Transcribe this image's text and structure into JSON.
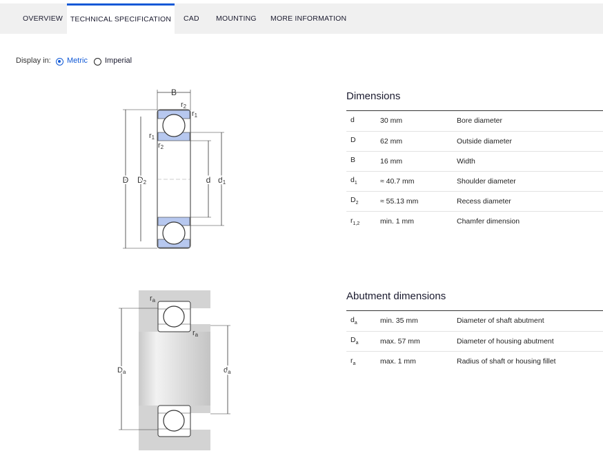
{
  "tabs": [
    {
      "label": "OVERVIEW",
      "active": false
    },
    {
      "label": "TECHNICAL SPECIFICATION",
      "active": true
    },
    {
      "label": "CAD",
      "active": false
    },
    {
      "label": "MOUNTING",
      "active": false
    },
    {
      "label": "MORE INFORMATION",
      "active": false
    }
  ],
  "display": {
    "label": "Display in:",
    "options": [
      {
        "label": "Metric",
        "selected": true
      },
      {
        "label": "Imperial",
        "selected": false
      }
    ]
  },
  "accent_color": "#0f58d6",
  "dimensions": {
    "title": "Dimensions",
    "rows": [
      {
        "symbol": "d",
        "sub": "",
        "value": "30 mm",
        "description": "Bore diameter"
      },
      {
        "symbol": "D",
        "sub": "",
        "value": "62 mm",
        "description": "Outside diameter"
      },
      {
        "symbol": "B",
        "sub": "",
        "value": "16 mm",
        "description": "Width"
      },
      {
        "symbol": "d",
        "sub": "1",
        "value": "≈ 40.7 mm",
        "description": "Shoulder diameter"
      },
      {
        "symbol": "D",
        "sub": "2",
        "value": "≈ 55.13 mm",
        "description": "Recess diameter"
      },
      {
        "symbol": "r",
        "sub": "1,2",
        "value": "min. 1 mm",
        "description": "Chamfer dimension"
      }
    ]
  },
  "abutment": {
    "title": "Abutment dimensions",
    "rows": [
      {
        "symbol": "d",
        "sub": "a",
        "value": "min. 35 mm",
        "description": "Diameter of shaft abutment"
      },
      {
        "symbol": "D",
        "sub": "a",
        "value": "max. 57 mm",
        "description": "Diameter of housing abutment"
      },
      {
        "symbol": "r",
        "sub": "a",
        "value": "max. 1 mm",
        "description": "Radius of shaft or housing fillet"
      }
    ]
  },
  "diagram1_labels": {
    "B": "B",
    "r2a": "r",
    "r2a_sub": "2",
    "r1a": "r",
    "r1a_sub": "1",
    "r1b": "r",
    "r1b_sub": "1",
    "r2b": "r",
    "r2b_sub": "2",
    "D": "D",
    "D2": "D",
    "D2_sub": "2",
    "d": "d",
    "d1": "d",
    "d1_sub": "1"
  },
  "diagram2_labels": {
    "ra_top": "r",
    "ra_top_sub": "a",
    "ra_mid": "r",
    "ra_mid_sub": "a",
    "Da": "D",
    "Da_sub": "a",
    "da": "d",
    "da_sub": "a"
  }
}
